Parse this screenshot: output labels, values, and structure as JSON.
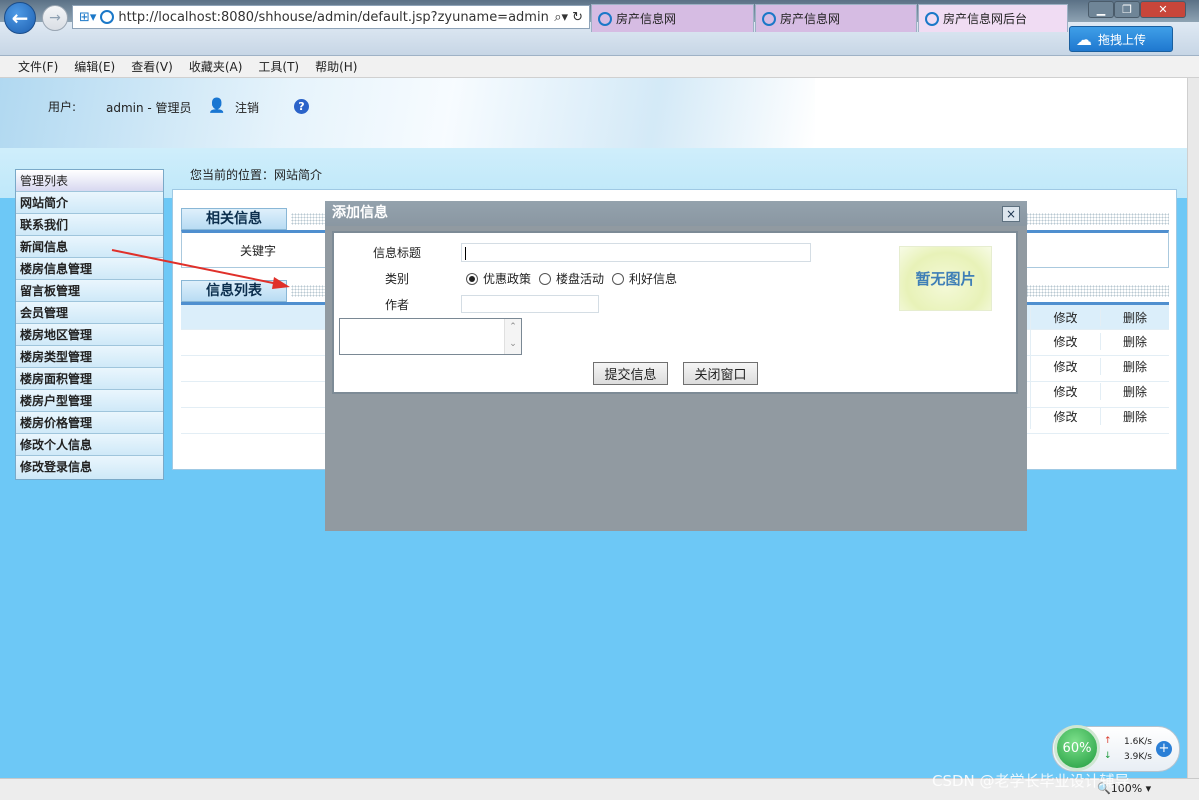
{
  "browser": {
    "url": "http://localhost:8080/shhouse/admin/default.jsp?zyuname=admin",
    "tabs": [
      "房产信息网",
      "房产信息网",
      "房产信息网后台"
    ],
    "upload_button": "拖拽上传",
    "menu": [
      "文件(F)",
      "编辑(E)",
      "查看(V)",
      "收藏夹(A)",
      "工具(T)",
      "帮助(H)"
    ],
    "zoom": "100%"
  },
  "header": {
    "user_label": "用户:",
    "user_value": "admin - 管理员",
    "logout": "注销",
    "help": "?"
  },
  "sidebar": {
    "title": "管理列表",
    "items": [
      "网站简介",
      "联系我们",
      "新闻信息",
      "楼房信息管理",
      "留言板管理",
      "会员管理",
      "楼房地区管理",
      "楼房类型管理",
      "楼房面积管理",
      "楼房户型管理",
      "楼房价格管理",
      "修改个人信息",
      "修改登录信息"
    ]
  },
  "breadcrumb": "您当前的位置：网站简介",
  "content": {
    "section1_title": "相关信息",
    "keyword_label": "关键字",
    "section2_title": "信息列表",
    "rows": [
      {
        "edit": "修改",
        "delete": "删除"
      },
      {
        "edit": "修改",
        "delete": "删除"
      },
      {
        "edit": "修改",
        "delete": "删除"
      },
      {
        "edit": "修改",
        "delete": "删除"
      },
      {
        "edit": "修改",
        "delete": "删除"
      }
    ]
  },
  "dialog": {
    "title": "添加信息",
    "close": "×",
    "field_title": "信息标题",
    "field_category": "类别",
    "categories": [
      "优惠政策",
      "楼盘活动",
      "利好信息"
    ],
    "selected_category": "优惠政策",
    "field_author": "作者",
    "no_image": "暂无图片",
    "submit": "提交信息",
    "close_window": "关闭窗口"
  },
  "widget": {
    "percent": "60%",
    "up_speed": "1.6K/s",
    "down_speed": "3.9K/s"
  },
  "watermark": "CSDN @老学长毕业设计辅导",
  "colors": {
    "accent": "#1b78c8",
    "page_bg": "#6dc8f6",
    "dialog": "#919aa1"
  }
}
